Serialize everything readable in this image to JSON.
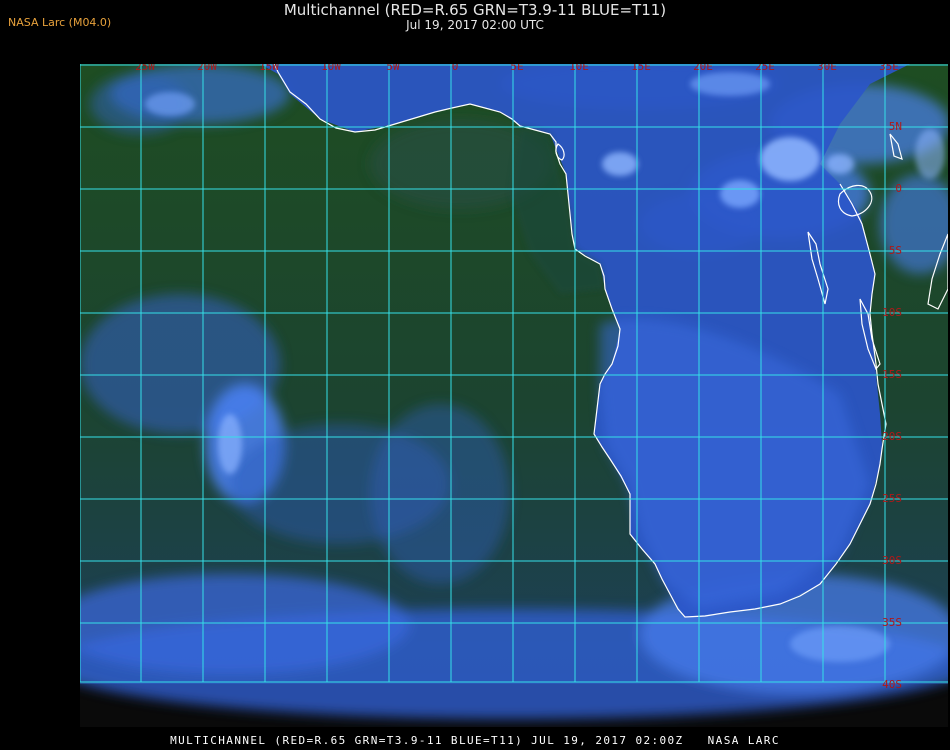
{
  "header": {
    "credit": "NASA Larc (M04.0)",
    "title": "Multichannel (RED=R.65 GRN=T3.9-11 BLUE=T11)",
    "subtitle": "Jul 19, 2017 02:00 UTC"
  },
  "map": {
    "grid_color": "#35e0e8",
    "label_color": "#b01818",
    "coast_color": "#ffffff",
    "ocean_color": "#1c4a20",
    "land_color": "#2a55c8",
    "cloud_color": "#4f8cff",
    "longitude_labels": [
      "25W",
      "20W",
      "15W",
      "10W",
      "5W",
      "0",
      "5E",
      "10E",
      "15E",
      "20E",
      "25E",
      "30E",
      "35E"
    ],
    "latitude_labels": [
      "5N",
      "0",
      "5S",
      "10S",
      "15S",
      "20S",
      "25S",
      "30S",
      "35S",
      "40S"
    ]
  },
  "footer": {
    "caption": "MULTICHANNEL (RED=R.65 GRN=T3.9-11 BLUE=T11) JUL 19, 2017 02:00Z   NASA LARC"
  }
}
